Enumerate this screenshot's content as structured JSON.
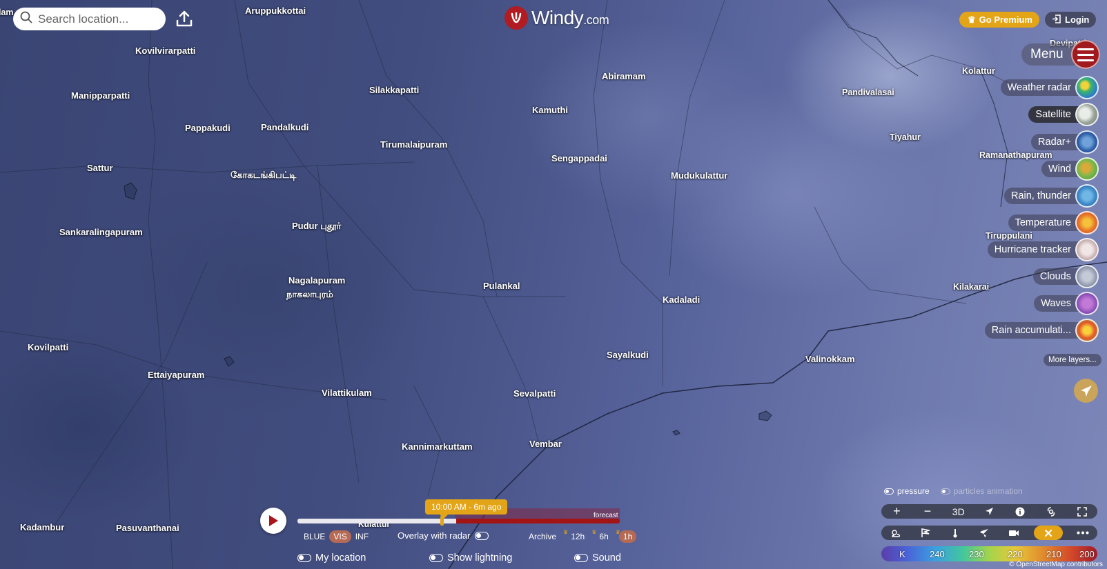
{
  "search": {
    "placeholder": "Search location..."
  },
  "logo": {
    "brand": "Windy",
    "tld": ".com"
  },
  "header": {
    "premium_label": "Go Premium",
    "login_label": "Login",
    "menu_label": "Menu"
  },
  "layers": [
    {
      "label": "Weather radar",
      "icon": "weather-radar-thumb",
      "active": false
    },
    {
      "label": "Satellite",
      "icon": "satellite-thumb",
      "active": true
    },
    {
      "label": "Radar+",
      "icon": "radar-plus-thumb",
      "active": false
    },
    {
      "label": "Wind",
      "icon": "wind-thumb",
      "active": false
    },
    {
      "label": "Rain, thunder",
      "icon": "rain-thunder-thumb",
      "active": false
    },
    {
      "label": "Temperature",
      "icon": "temperature-thumb",
      "active": false
    },
    {
      "label": "Hurricane tracker",
      "icon": "hurricane-thumb",
      "active": false
    },
    {
      "label": "Clouds",
      "icon": "clouds-thumb",
      "active": false
    },
    {
      "label": "Waves",
      "icon": "waves-thumb",
      "active": false
    },
    {
      "label": "Rain accumulati...",
      "icon": "rain-accumulation-thumb",
      "active": false
    }
  ],
  "more_layers": "More layers...",
  "map_options": {
    "pressure": "pressure",
    "particles": "particles animation"
  },
  "controls_top": [
    "+",
    "−",
    "3D"
  ],
  "scale": {
    "unit": "K",
    "ticks": [
      "240",
      "230",
      "220",
      "210",
      "200"
    ]
  },
  "attribution": "© OpenStreetMap contributors",
  "timeline": {
    "time_label": "10:00 AM - 6m ago",
    "forecast_label": "forecast",
    "bands": [
      "BLUE",
      "VIS",
      "INF"
    ],
    "active_band": "VIS",
    "overlay_label": "Overlay with radar",
    "archive_label": "Archive",
    "steps": [
      "12h",
      "6h",
      "1h"
    ],
    "active_step": "1h"
  },
  "options": {
    "my_location": "My location",
    "show_lightning": "Show lightning",
    "sound": "Sound"
  },
  "places": [
    "Aruppukkottai",
    "Kovilvirarpatti",
    "Manipparpatti",
    "Silakkapatti",
    "Abiramam",
    "Kamuthi",
    "Pappakudi",
    "Pandalkudi",
    "Tirumalaipuram",
    "Sengappadai",
    "Sattur",
    "கோகடங்கிபட்டி",
    "Mudukulattur",
    "Sankaralingapuram",
    "Pudur புதூர்",
    "Nagalapuram",
    "நாகலாபுரம்",
    "Pulankal",
    "Kadaladi",
    "Kovilpatti",
    "Ettaiyapuram",
    "Sayalkudi",
    "Vilattikulam",
    "Sevalpatti",
    "Valinokkam",
    "Kannimarkuttam",
    "Vembar",
    "Kadambur",
    "Pasuvanthanai",
    "Kulattur",
    "Kolattur",
    "Pandivalasai",
    "Tiyahur",
    "Ramanathapuram",
    "Tiruppulani",
    "Kilakarai",
    "Devipattinam",
    "lam"
  ]
}
